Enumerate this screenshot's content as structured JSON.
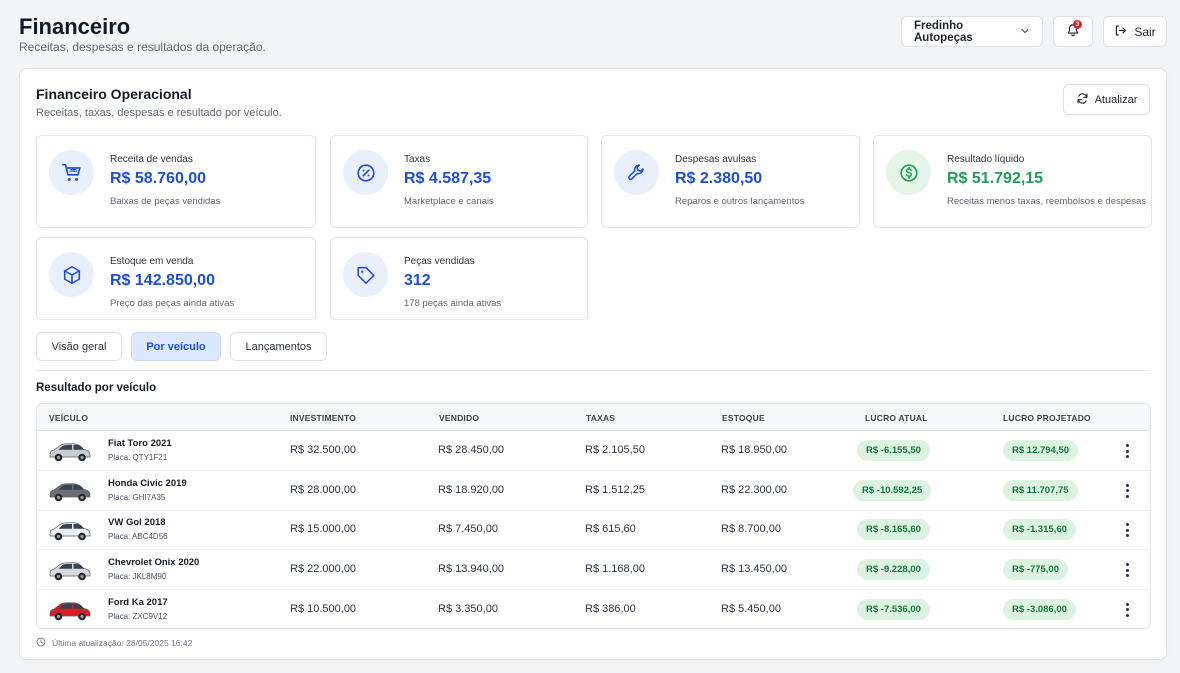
{
  "header": {
    "title": "Financeiro",
    "subtitle": "Receitas, despesas e resultados da operação.",
    "store_label": "Fredinho Autopeças",
    "notification_count": "3",
    "logout_label": "Sair"
  },
  "section": {
    "title": "Financeiro Operacional",
    "subtitle": "Receitas, taxas, despesas e resultado por veículo.",
    "refresh_label": "Atualizar"
  },
  "stats": [
    {
      "label": "Receita de vendas",
      "value": "R$ 58.760,00",
      "desc": "Baixas de peças vendidas",
      "icon": "cart-icon"
    },
    {
      "label": "Taxas",
      "value": "R$ 4.587,35",
      "desc": "Marketplace e canais",
      "icon": "percent-icon"
    },
    {
      "label": "Despesas avulsas",
      "value": "R$ 2.380,50",
      "desc": "Reparos e outros lançamentos",
      "icon": "wrench-icon"
    },
    {
      "label": "Resultado líquido",
      "value": "R$ 51.792,15",
      "desc": "Receitas menos taxas, reembolsos e despesas",
      "icon": "dollar-icon",
      "color": "#1f9d55"
    },
    {
      "label": "Estoque em venda",
      "value": "R$ 142.850,00",
      "desc": "Preço das peças ainda ativas",
      "icon": "box-icon"
    },
    {
      "label": "Peças vendidas",
      "value": "312",
      "desc": "178 peças ainda ativas",
      "icon": "tag-icon"
    }
  ],
  "tabs": [
    {
      "label": "Visão geral",
      "active": false
    },
    {
      "label": "Por veículo",
      "active": true
    },
    {
      "label": "Lançamentos",
      "active": false
    }
  ],
  "table": {
    "title": "Resultado por veículo",
    "columns": [
      "VEÍCULO",
      "INVESTIMENTO",
      "VENDIDO",
      "TAXAS",
      "ESTOQUE",
      "LUCRO ATUAL",
      "LUCRO PROJETADO"
    ],
    "rows": [
      {
        "name": "Fiat Toro 2021",
        "plate": "Placa: QTY1F21",
        "car_color": "#c9ccd1",
        "investimento": "R$ 32.500,00",
        "vendido": "R$ 28.450,00",
        "taxas": "R$ 2.105,50",
        "estoque": "R$ 18.950,00",
        "lucro_atual": "R$ -6.155,50",
        "lucro_projetado": "R$ 12.794,50"
      },
      {
        "name": "Honda Civic 2019",
        "plate": "Placa: GHI7A35",
        "car_color": "#6b6f75",
        "investimento": "R$ 28.000,00",
        "vendido": "R$ 18.920,00",
        "taxas": "R$ 1.512,25",
        "estoque": "R$ 22.300,00",
        "lucro_atual": "R$ -10.592,25",
        "lucro_projetado": "R$ 11.707,75"
      },
      {
        "name": "VW Gol 2018",
        "plate": "Placa: ABC4D56",
        "car_color": "#eceef0",
        "investimento": "R$ 15.000,00",
        "vendido": "R$ 7.450,00",
        "taxas": "R$ 615,60",
        "estoque": "R$ 8.700,00",
        "lucro_atual": "R$ -8.165,60",
        "lucro_projetado": "R$ -1.315,60"
      },
      {
        "name": "Chevrolet Onix 2020",
        "plate": "Placa: JKL8M90",
        "car_color": "#d7d9dc",
        "investimento": "R$ 22.000,00",
        "vendido": "R$ 13.940,00",
        "taxas": "R$ 1.168,00",
        "estoque": "R$ 13.450,00",
        "lucro_atual": "R$ -9.228,00",
        "lucro_projetado": "R$ -775,00"
      },
      {
        "name": "Ford Ka 2017",
        "plate": "Placa: ZXC9V12",
        "car_color": "#d81e26",
        "investimento": "R$ 10.500,00",
        "vendido": "R$ 3.350,00",
        "taxas": "R$ 386,00",
        "estoque": "R$ 5.450,00",
        "lucro_atual": "R$ -7.536,00",
        "lucro_projetado": "R$ -3.086,00"
      }
    ]
  },
  "footer": {
    "last_update": "Última atualização: 28/05/2025 16:42"
  },
  "colors": {
    "accent": "#1d4ed8",
    "positive": "#1f9d55",
    "pill_bg": "#dcf3e2",
    "pill_text": "#137a3c"
  }
}
